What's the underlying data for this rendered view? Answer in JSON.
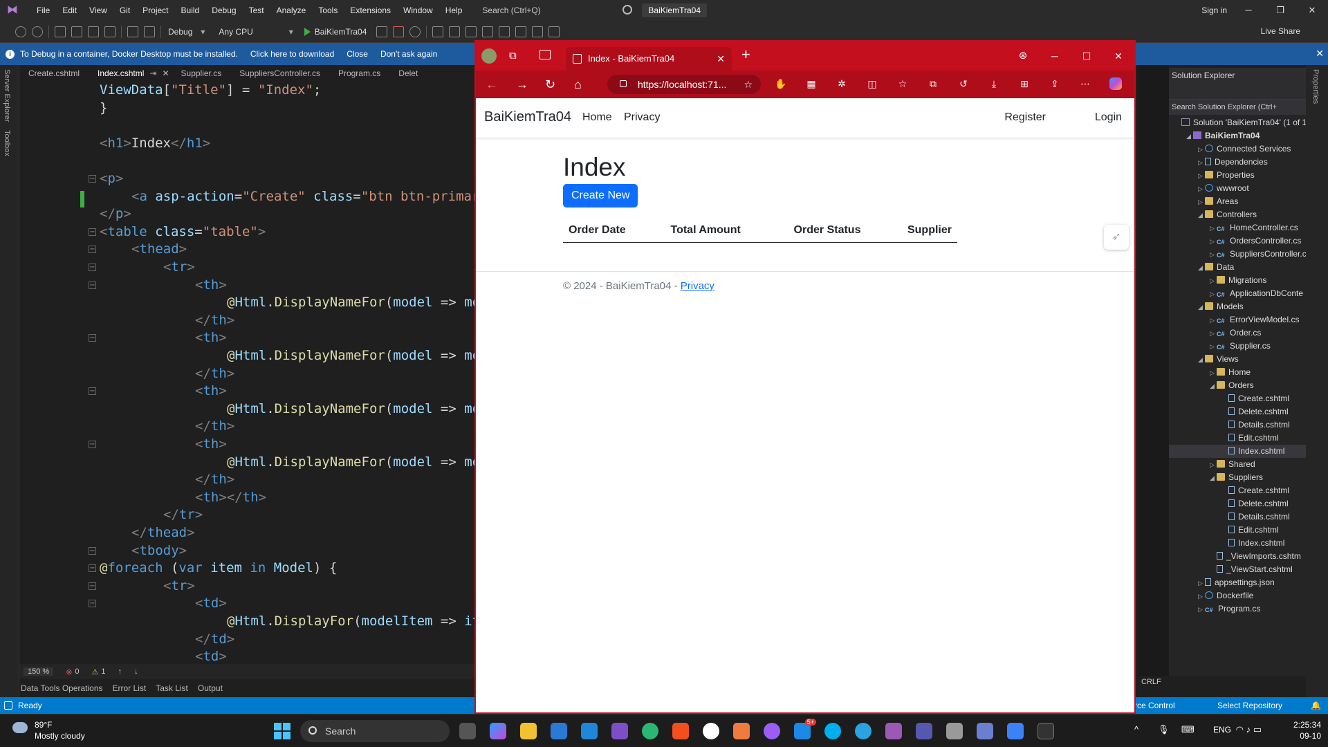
{
  "menubar": {
    "items": [
      "File",
      "Edit",
      "View",
      "Git",
      "Project",
      "Build",
      "Debug",
      "Test",
      "Analyze",
      "Tools",
      "Extensions",
      "Window",
      "Help"
    ],
    "search_placeholder": "Search (Ctrl+Q)",
    "solution_name": "BaiKiemTra04",
    "sign_in": "Sign in"
  },
  "toolbar": {
    "config": "Debug",
    "platform": "Any CPU",
    "run_target": "BaiKiemTra04",
    "live_share": "Live Share"
  },
  "infobar": {
    "message": "To Debug in a container, Docker Desktop must be installed.",
    "download_link": "Click here to download",
    "close_link": "Close",
    "dont_ask_link": "Don't ask again"
  },
  "left_strip": {
    "server_explorer": "Server Explorer",
    "toolbox": "Toolbox"
  },
  "doc_tabs": [
    "Create.cshtml",
    "Index.cshtml",
    "Supplier.cs",
    "SuppliersController.cs",
    "Program.cs",
    "Delet"
  ],
  "editor": {
    "lines": [
      {
        "i": 0,
        "segs": [
          [
            "t-id",
            "ViewData"
          ],
          [
            "t-txt",
            "["
          ],
          [
            "t-str",
            "\"Title\""
          ],
          [
            "t-txt",
            "] = "
          ],
          [
            "t-str",
            "\"Index\""
          ],
          [
            "t-txt",
            ";"
          ]
        ]
      },
      {
        "i": 0,
        "segs": [
          [
            "t-txt",
            "}"
          ]
        ]
      },
      {
        "i": 0,
        "segs": []
      },
      {
        "i": 0,
        "segs": [
          [
            "t-tag",
            "<"
          ],
          [
            "t-tn",
            "h1"
          ],
          [
            "t-tag",
            ">"
          ],
          [
            "t-txt",
            "Index"
          ],
          [
            "t-tag",
            "</"
          ],
          [
            "t-tn",
            "h1"
          ],
          [
            "t-tag",
            ">"
          ]
        ]
      },
      {
        "i": 0,
        "segs": []
      },
      {
        "i": 0,
        "segs": [
          [
            "t-tag",
            "<"
          ],
          [
            "t-tn",
            "p"
          ],
          [
            "t-tag",
            ">"
          ]
        ]
      },
      {
        "i": 1,
        "segs": [
          [
            "t-tag",
            "<"
          ],
          [
            "t-tn",
            "a "
          ],
          [
            "t-attr",
            "asp-action"
          ],
          [
            "t-txt",
            "="
          ],
          [
            "t-str",
            "\"Create\""
          ],
          [
            "t-txt",
            " "
          ],
          [
            "t-attr",
            "class"
          ],
          [
            "t-txt",
            "="
          ],
          [
            "t-str",
            "\"btn btn-primary\""
          ]
        ]
      },
      {
        "i": 0,
        "segs": [
          [
            "t-tag",
            "</"
          ],
          [
            "t-tn",
            "p"
          ],
          [
            "t-tag",
            ">"
          ]
        ]
      },
      {
        "i": 0,
        "segs": [
          [
            "t-tag",
            "<"
          ],
          [
            "t-tn",
            "table "
          ],
          [
            "t-attr",
            "class"
          ],
          [
            "t-txt",
            "="
          ],
          [
            "t-str",
            "\"table\""
          ],
          [
            "t-tag",
            ">"
          ]
        ]
      },
      {
        "i": 1,
        "segs": [
          [
            "t-tag",
            "<"
          ],
          [
            "t-tn",
            "thead"
          ],
          [
            "t-tag",
            ">"
          ]
        ]
      },
      {
        "i": 2,
        "segs": [
          [
            "t-tag",
            "<"
          ],
          [
            "t-tn",
            "tr"
          ],
          [
            "t-tag",
            ">"
          ]
        ]
      },
      {
        "i": 3,
        "segs": [
          [
            "t-tag",
            "<"
          ],
          [
            "t-tn",
            "th"
          ],
          [
            "t-tag",
            ">"
          ]
        ]
      },
      {
        "i": 4,
        "segs": [
          [
            "t-razor",
            "@"
          ],
          [
            "t-id",
            "Html"
          ],
          [
            "t-txt",
            "."
          ],
          [
            "t-fn",
            "DisplayNameFor"
          ],
          [
            "t-txt",
            "("
          ],
          [
            "t-id",
            "model"
          ],
          [
            "t-txt",
            " => "
          ],
          [
            "t-id",
            "mode"
          ]
        ]
      },
      {
        "i": 3,
        "segs": [
          [
            "t-tag",
            "</"
          ],
          [
            "t-tn",
            "th"
          ],
          [
            "t-tag",
            ">"
          ]
        ]
      },
      {
        "i": 3,
        "segs": [
          [
            "t-tag",
            "<"
          ],
          [
            "t-tn",
            "th"
          ],
          [
            "t-tag",
            ">"
          ]
        ]
      },
      {
        "i": 4,
        "segs": [
          [
            "t-razor",
            "@"
          ],
          [
            "t-id",
            "Html"
          ],
          [
            "t-txt",
            "."
          ],
          [
            "t-fn",
            "DisplayNameFor"
          ],
          [
            "t-txt",
            "("
          ],
          [
            "t-id",
            "model"
          ],
          [
            "t-txt",
            " => "
          ],
          [
            "t-id",
            "mode"
          ]
        ]
      },
      {
        "i": 3,
        "segs": [
          [
            "t-tag",
            "</"
          ],
          [
            "t-tn",
            "th"
          ],
          [
            "t-tag",
            ">"
          ]
        ]
      },
      {
        "i": 3,
        "segs": [
          [
            "t-tag",
            "<"
          ],
          [
            "t-tn",
            "th"
          ],
          [
            "t-tag",
            ">"
          ]
        ]
      },
      {
        "i": 4,
        "segs": [
          [
            "t-razor",
            "@"
          ],
          [
            "t-id",
            "Html"
          ],
          [
            "t-txt",
            "."
          ],
          [
            "t-fn",
            "DisplayNameFor"
          ],
          [
            "t-txt",
            "("
          ],
          [
            "t-id",
            "model"
          ],
          [
            "t-txt",
            " => "
          ],
          [
            "t-id",
            "mode"
          ]
        ]
      },
      {
        "i": 3,
        "segs": [
          [
            "t-tag",
            "</"
          ],
          [
            "t-tn",
            "th"
          ],
          [
            "t-tag",
            ">"
          ]
        ]
      },
      {
        "i": 3,
        "segs": [
          [
            "t-tag",
            "<"
          ],
          [
            "t-tn",
            "th"
          ],
          [
            "t-tag",
            ">"
          ]
        ]
      },
      {
        "i": 4,
        "segs": [
          [
            "t-razor",
            "@"
          ],
          [
            "t-id",
            "Html"
          ],
          [
            "t-txt",
            "."
          ],
          [
            "t-fn",
            "DisplayNameFor"
          ],
          [
            "t-txt",
            "("
          ],
          [
            "t-id",
            "model"
          ],
          [
            "t-txt",
            " => "
          ],
          [
            "t-id",
            "mode"
          ]
        ]
      },
      {
        "i": 3,
        "segs": [
          [
            "t-tag",
            "</"
          ],
          [
            "t-tn",
            "th"
          ],
          [
            "t-tag",
            ">"
          ]
        ]
      },
      {
        "i": 3,
        "segs": [
          [
            "t-tag",
            "<"
          ],
          [
            "t-tn",
            "th"
          ],
          [
            "t-tag",
            "></"
          ],
          [
            "t-tn",
            "th"
          ],
          [
            "t-tag",
            ">"
          ]
        ]
      },
      {
        "i": 2,
        "segs": [
          [
            "t-tag",
            "</"
          ],
          [
            "t-tn",
            "tr"
          ],
          [
            "t-tag",
            ">"
          ]
        ]
      },
      {
        "i": 1,
        "segs": [
          [
            "t-tag",
            "</"
          ],
          [
            "t-tn",
            "thead"
          ],
          [
            "t-tag",
            ">"
          ]
        ]
      },
      {
        "i": 1,
        "segs": [
          [
            "t-tag",
            "<"
          ],
          [
            "t-tn",
            "tbody"
          ],
          [
            "t-tag",
            ">"
          ]
        ]
      },
      {
        "i": 0,
        "segs": [
          [
            "t-razor",
            "@"
          ],
          [
            "t-kw",
            "foreach"
          ],
          [
            "t-txt",
            " ("
          ],
          [
            "t-kw",
            "var"
          ],
          [
            "t-txt",
            " "
          ],
          [
            "t-id",
            "item"
          ],
          [
            "t-txt",
            " "
          ],
          [
            "t-kw",
            "in"
          ],
          [
            "t-txt",
            " "
          ],
          [
            "t-id",
            "Model"
          ],
          [
            "t-txt",
            ") {"
          ]
        ]
      },
      {
        "i": 2,
        "segs": [
          [
            "t-tag",
            "<"
          ],
          [
            "t-tn",
            "tr"
          ],
          [
            "t-tag",
            ">"
          ]
        ]
      },
      {
        "i": 3,
        "segs": [
          [
            "t-tag",
            "<"
          ],
          [
            "t-tn",
            "td"
          ],
          [
            "t-tag",
            ">"
          ]
        ]
      },
      {
        "i": 4,
        "segs": [
          [
            "t-razor",
            "@"
          ],
          [
            "t-id",
            "Html"
          ],
          [
            "t-txt",
            "."
          ],
          [
            "t-fn",
            "DisplayFor"
          ],
          [
            "t-txt",
            "("
          ],
          [
            "t-id",
            "modelItem"
          ],
          [
            "t-txt",
            " => "
          ],
          [
            "t-id",
            "item"
          ]
        ]
      },
      {
        "i": 3,
        "segs": [
          [
            "t-tag",
            "</"
          ],
          [
            "t-tn",
            "td"
          ],
          [
            "t-tag",
            ">"
          ]
        ]
      },
      {
        "i": 3,
        "segs": [
          [
            "t-tag",
            "<"
          ],
          [
            "t-tn",
            "td"
          ],
          [
            "t-tag",
            ">"
          ]
        ]
      }
    ]
  },
  "editor_status": {
    "zoom": "150 %",
    "errors": "0",
    "warnings": "1"
  },
  "bottom_tabs": [
    "Data Tools Operations",
    "Error List",
    "Task List",
    "Output"
  ],
  "vs_status": {
    "ready": "Ready",
    "line_ending": "CRLF",
    "source_control": "rce Control",
    "select_repo": "Select Repository"
  },
  "solution_explorer": {
    "title": "Solution Explorer",
    "search_placeholder": "Search Solution Explorer (Ctrl+",
    "tree": [
      {
        "label": "Solution 'BaiKiemTra04' (1 of 1",
        "level": 0,
        "icon": "sol",
        "tw": ""
      },
      {
        "label": "BaiKiemTra04",
        "level": 1,
        "icon": "proj",
        "tw": "◢",
        "bold": true
      },
      {
        "label": "Connected Services",
        "level": 2,
        "icon": "globe",
        "tw": "▷"
      },
      {
        "label": "Dependencies",
        "level": 2,
        "icon": "file",
        "tw": "▷"
      },
      {
        "label": "Properties",
        "level": 2,
        "icon": "folder",
        "tw": "▷"
      },
      {
        "label": "wwwroot",
        "level": 2,
        "icon": "globe",
        "tw": "▷"
      },
      {
        "label": "Areas",
        "level": 2,
        "icon": "folder",
        "tw": "▷"
      },
      {
        "label": "Controllers",
        "level": 2,
        "icon": "folder",
        "tw": "◢"
      },
      {
        "label": "HomeController.cs",
        "level": 3,
        "icon": "cs",
        "tw": "▷"
      },
      {
        "label": "OrdersController.cs",
        "level": 3,
        "icon": "cs",
        "tw": "▷"
      },
      {
        "label": "SuppliersController.c",
        "level": 3,
        "icon": "cs",
        "tw": "▷"
      },
      {
        "label": "Data",
        "level": 2,
        "icon": "folder",
        "tw": "◢"
      },
      {
        "label": "Migrations",
        "level": 3,
        "icon": "folder",
        "tw": "▷"
      },
      {
        "label": "ApplicationDbConte",
        "level": 3,
        "icon": "cs",
        "tw": "▷"
      },
      {
        "label": "Models",
        "level": 2,
        "icon": "folder",
        "tw": "◢"
      },
      {
        "label": "ErrorViewModel.cs",
        "level": 3,
        "icon": "cs",
        "tw": "▷"
      },
      {
        "label": "Order.cs",
        "level": 3,
        "icon": "cs",
        "tw": "▷"
      },
      {
        "label": "Supplier.cs",
        "level": 3,
        "icon": "cs",
        "tw": "▷"
      },
      {
        "label": "Views",
        "level": 2,
        "icon": "folder",
        "tw": "◢"
      },
      {
        "label": "Home",
        "level": 3,
        "icon": "folder",
        "tw": "▷"
      },
      {
        "label": "Orders",
        "level": 3,
        "icon": "folder",
        "tw": "◢"
      },
      {
        "label": "Create.cshtml",
        "level": 4,
        "icon": "file",
        "tw": ""
      },
      {
        "label": "Delete.cshtml",
        "level": 4,
        "icon": "file",
        "tw": ""
      },
      {
        "label": "Details.cshtml",
        "level": 4,
        "icon": "file",
        "tw": ""
      },
      {
        "label": "Edit.cshtml",
        "level": 4,
        "icon": "file",
        "tw": ""
      },
      {
        "label": "Index.cshtml",
        "level": 4,
        "icon": "file",
        "tw": "",
        "selected": true
      },
      {
        "label": "Shared",
        "level": 3,
        "icon": "folder",
        "tw": "▷"
      },
      {
        "label": "Suppliers",
        "level": 3,
        "icon": "folder",
        "tw": "◢"
      },
      {
        "label": "Create.cshtml",
        "level": 4,
        "icon": "file",
        "tw": ""
      },
      {
        "label": "Delete.cshtml",
        "level": 4,
        "icon": "file",
        "tw": ""
      },
      {
        "label": "Details.cshtml",
        "level": 4,
        "icon": "file",
        "tw": ""
      },
      {
        "label": "Edit.cshtml",
        "level": 4,
        "icon": "file",
        "tw": ""
      },
      {
        "label": "Index.cshtml",
        "level": 4,
        "icon": "file",
        "tw": ""
      },
      {
        "label": "_ViewImports.cshtm",
        "level": 3,
        "icon": "file",
        "tw": ""
      },
      {
        "label": "_ViewStart.cshtml",
        "level": 3,
        "icon": "file",
        "tw": ""
      },
      {
        "label": "appsettings.json",
        "level": 2,
        "icon": "file",
        "tw": "▷"
      },
      {
        "label": "Dockerfile",
        "level": 2,
        "icon": "globe",
        "tw": "▷"
      },
      {
        "label": "Program.cs",
        "level": 2,
        "icon": "cs",
        "tw": "▷"
      }
    ]
  },
  "browser": {
    "tab_title": "Index - BaiKiemTra04",
    "url": "https://localhost:71...",
    "accent": "#c40f1f"
  },
  "page": {
    "brand": "BaiKiemTra04",
    "nav": {
      "home": "Home",
      "privacy": "Privacy",
      "register": "Register",
      "login": "Login"
    },
    "heading": "Index",
    "create_button": "Create New",
    "columns": [
      "Order Date",
      "Total Amount",
      "Order Status",
      "Supplier"
    ],
    "footer_text": "© 2024 - BaiKiemTra04 - ",
    "footer_link": "Privacy",
    "primary_color": "#0d6efd"
  },
  "taskbar": {
    "temperature": "89°F",
    "weather": "Mostly cloudy",
    "search_placeholder": "Search",
    "language": "ENG",
    "time": "2:25:34",
    "date": "09-10",
    "badge": "5+"
  }
}
